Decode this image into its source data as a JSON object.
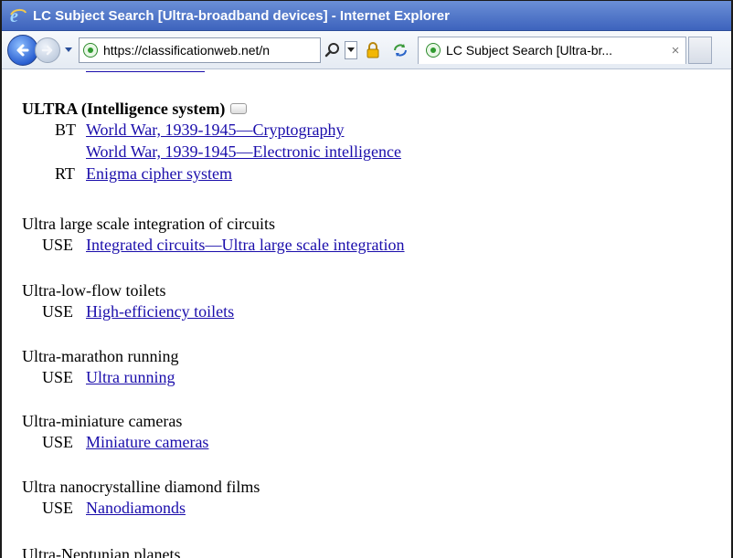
{
  "window": {
    "title": "LC Subject Search [Ultra-broadband devices] - Internet Explorer"
  },
  "toolbar": {
    "url": "https://classificationweb.net/n",
    "tab_title": "LC Subject Search [Ultra-br...",
    "tab_close": "×"
  },
  "entries": [
    {
      "heading": "ULTRA (Intelligence system)",
      "bold": true,
      "refs": [
        {
          "label": "BT",
          "link": "World War, 1939-1945—Cryptography"
        },
        {
          "label": "",
          "link": "World War, 1939-1945—Electronic intelligence"
        },
        {
          "label": "RT",
          "link": "Enigma cipher system"
        }
      ]
    },
    {
      "heading": "Ultra large scale integration of circuits",
      "refs": [
        {
          "label": "USE",
          "link": "Integrated circuits—Ultra large scale integration"
        }
      ]
    },
    {
      "heading": "Ultra-low-flow toilets",
      "refs": [
        {
          "label": "USE",
          "link": "High-efficiency toilets"
        }
      ]
    },
    {
      "heading": "Ultra-marathon running",
      "refs": [
        {
          "label": "USE",
          "link": "Ultra running"
        }
      ]
    },
    {
      "heading": "Ultra-miniature cameras",
      "refs": [
        {
          "label": "USE",
          "link": "Miniature cameras"
        }
      ]
    },
    {
      "heading": "Ultra nanocrystalline diamond films",
      "refs": [
        {
          "label": "USE",
          "link": "Nanodiamonds"
        }
      ]
    },
    {
      "heading": "Ultra-Neptunian planets"
    }
  ],
  "icons": {
    "app": "internet-explorer-logo",
    "back": "back-arrow-icon",
    "forward": "forward-arrow-icon",
    "site": "site-identity-icon",
    "search": "search-icon",
    "lock": "lock-icon",
    "refresh": "refresh-icon",
    "note": "note-icon"
  },
  "colors": {
    "titlebar": "#3d63bd",
    "link": "#1a0dab"
  }
}
